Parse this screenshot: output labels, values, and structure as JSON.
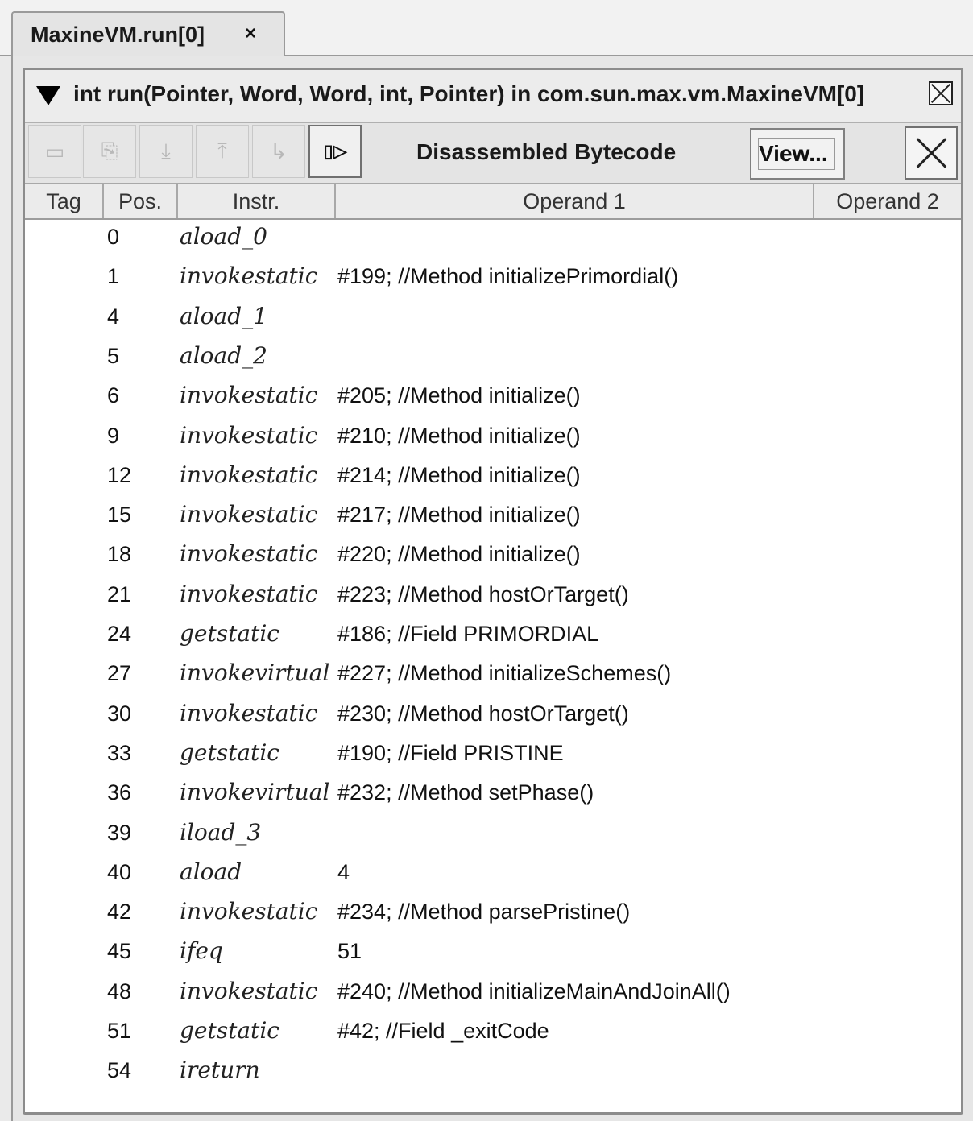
{
  "tab": {
    "title": "MaxineVM.run[0]",
    "close_glyph": "×"
  },
  "inspector": {
    "method_title": "int run(Pointer, Word, Word, int, Pointer)  in  com.sun.max.vm.MaxineVM[0]",
    "collapse_icon": "triangle-down",
    "view_title": "Disassembled Bytecode",
    "view_button": "View...",
    "toolbar_buttons": [
      {
        "name": "toolbar-button-1",
        "glyph": "▭",
        "enabled": false
      },
      {
        "name": "toolbar-button-2",
        "glyph": "⎘",
        "enabled": false
      },
      {
        "name": "toolbar-button-3",
        "glyph": "⤓",
        "enabled": false
      },
      {
        "name": "toolbar-button-4",
        "glyph": "⤒",
        "enabled": false
      },
      {
        "name": "toolbar-button-5",
        "glyph": "↳",
        "enabled": false
      },
      {
        "name": "toolbar-button-6",
        "glyph": "▯▷",
        "enabled": true
      }
    ]
  },
  "table": {
    "columns": [
      "Tag",
      "Pos.",
      "Instr.",
      "Operand 1",
      "Operand 2"
    ],
    "rows": [
      {
        "pos": "0",
        "instr": "aload_0",
        "op1": ""
      },
      {
        "pos": "1",
        "instr": "invokestatic",
        "op1": "#199; //Method initializePrimordial()"
      },
      {
        "pos": "4",
        "instr": "aload_1",
        "op1": ""
      },
      {
        "pos": "5",
        "instr": "aload_2",
        "op1": ""
      },
      {
        "pos": "6",
        "instr": "invokestatic",
        "op1": "#205; //Method initialize()"
      },
      {
        "pos": "9",
        "instr": "invokestatic",
        "op1": "#210; //Method initialize()"
      },
      {
        "pos": "12",
        "instr": "invokestatic",
        "op1": "#214; //Method initialize()"
      },
      {
        "pos": "15",
        "instr": "invokestatic",
        "op1": "#217; //Method initialize()"
      },
      {
        "pos": "18",
        "instr": "invokestatic",
        "op1": "#220; //Method initialize()"
      },
      {
        "pos": "21",
        "instr": "invokestatic",
        "op1": "#223; //Method hostOrTarget()"
      },
      {
        "pos": "24",
        "instr": "getstatic",
        "op1": "#186; //Field PRIMORDIAL"
      },
      {
        "pos": "27",
        "instr": "invokevirtual",
        "op1": "#227; //Method initializeSchemes()"
      },
      {
        "pos": "30",
        "instr": "invokestatic",
        "op1": "#230; //Method hostOrTarget()"
      },
      {
        "pos": "33",
        "instr": "getstatic",
        "op1": "#190; //Field PRISTINE"
      },
      {
        "pos": "36",
        "instr": "invokevirtual",
        "op1": "#232; //Method setPhase()"
      },
      {
        "pos": "39",
        "instr": "iload_3",
        "op1": ""
      },
      {
        "pos": "40",
        "instr": "aload",
        "op1": "4"
      },
      {
        "pos": "42",
        "instr": "invokestatic",
        "op1": "#234; //Method parsePristine()"
      },
      {
        "pos": "45",
        "instr": "ifeq",
        "op1": "51"
      },
      {
        "pos": "48",
        "instr": "invokestatic",
        "op1": "#240; //Method initializeMainAndJoinAll()"
      },
      {
        "pos": "51",
        "instr": "getstatic",
        "op1": "#42; //Field _exitCode"
      },
      {
        "pos": "54",
        "instr": "ireturn",
        "op1": ""
      }
    ]
  }
}
